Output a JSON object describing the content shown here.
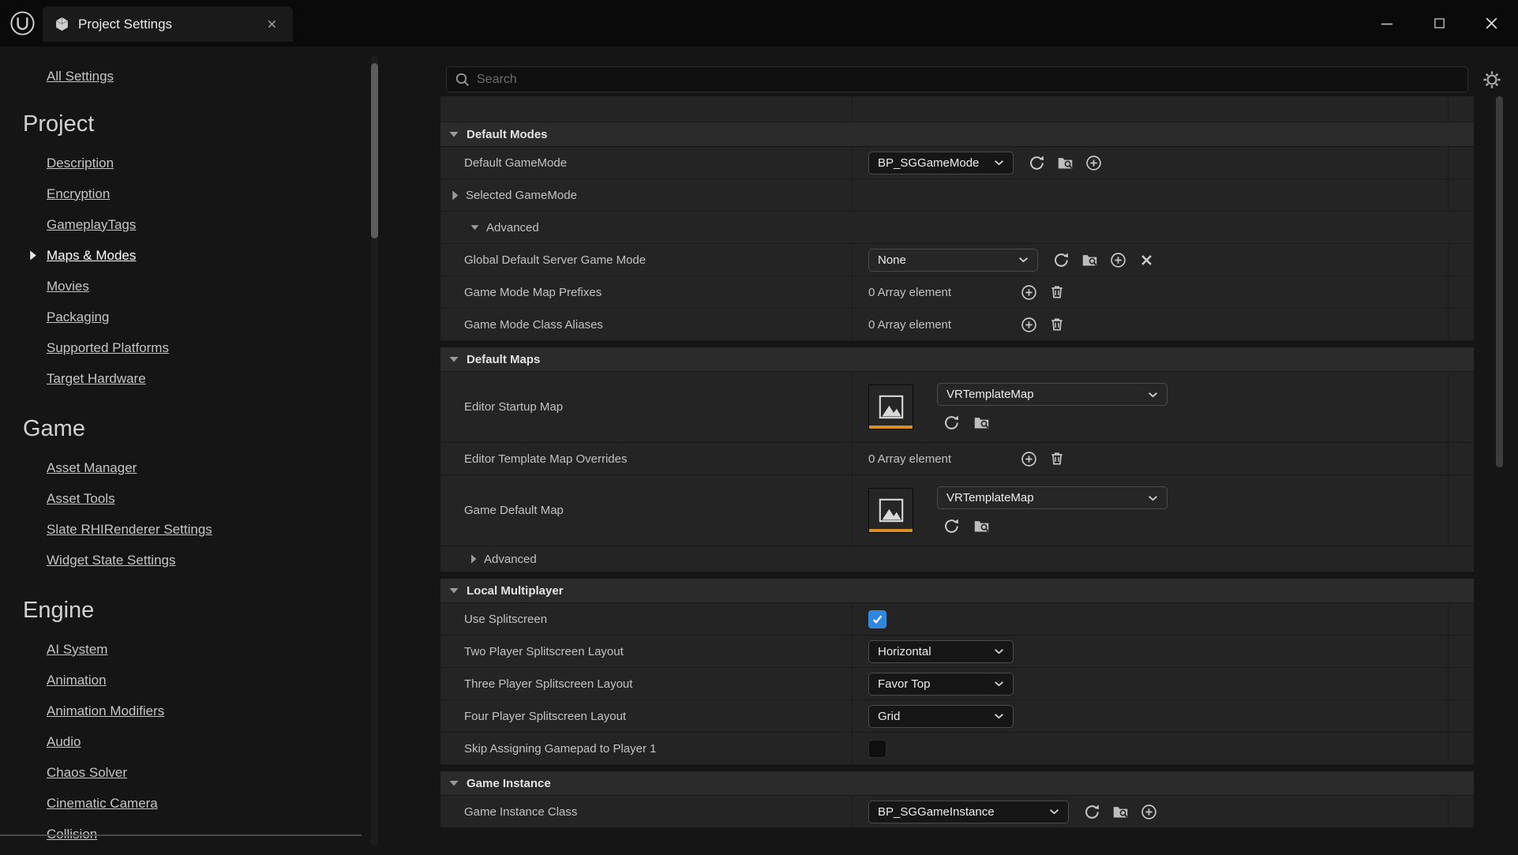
{
  "window": {
    "tab_title": "Project Settings"
  },
  "sidebar": {
    "all_settings": "All Settings",
    "selected_item": "Maps & Modes",
    "sections": [
      {
        "title": "Project",
        "items": [
          "Description",
          "Encryption",
          "GameplayTags",
          "Maps & Modes",
          "Movies",
          "Packaging",
          "Supported Platforms",
          "Target Hardware"
        ]
      },
      {
        "title": "Game",
        "items": [
          "Asset Manager",
          "Asset Tools",
          "Slate RHIRenderer Settings",
          "Widget State Settings"
        ]
      },
      {
        "title": "Engine",
        "items": [
          "AI System",
          "Animation",
          "Animation Modifiers",
          "Audio",
          "Chaos Solver",
          "Cinematic Camera",
          "Collision"
        ]
      }
    ]
  },
  "search": {
    "placeholder": "Search"
  },
  "panel": {
    "default_modes": {
      "title": "Default Modes",
      "default_gamemode": {
        "label": "Default GameMode",
        "value": "BP_SGGameMode"
      },
      "selected_gamemode": {
        "label": "Selected GameMode"
      },
      "advanced": {
        "label": "Advanced",
        "expanded": true
      },
      "global_default_server_game_mode": {
        "label": "Global Default Server Game Mode",
        "value": "None"
      },
      "game_mode_map_prefixes": {
        "label": "Game Mode Map Prefixes",
        "value": "0 Array element"
      },
      "game_mode_class_aliases": {
        "label": "Game Mode Class Aliases",
        "value": "0 Array element"
      }
    },
    "default_maps": {
      "title": "Default Maps",
      "editor_startup_map": {
        "label": "Editor Startup Map",
        "value": "VRTemplateMap"
      },
      "editor_template_map_overrides": {
        "label": "Editor Template Map Overrides",
        "value": "0 Array element"
      },
      "game_default_map": {
        "label": "Game Default Map",
        "value": "VRTemplateMap"
      },
      "advanced": {
        "label": "Advanced",
        "expanded": false
      }
    },
    "local_multiplayer": {
      "title": "Local Multiplayer",
      "use_splitscreen": {
        "label": "Use Splitscreen",
        "checked": true
      },
      "two_player_splitscreen_layout": {
        "label": "Two Player Splitscreen Layout",
        "value": "Horizontal"
      },
      "three_player_splitscreen_layout": {
        "label": "Three Player Splitscreen Layout",
        "value": "Favor Top"
      },
      "four_player_splitscreen_layout": {
        "label": "Four Player Splitscreen Layout",
        "value": "Grid"
      },
      "skip_assigning_gamepad": {
        "label": "Skip Assigning Gamepad to Player 1",
        "checked": false
      }
    },
    "game_instance": {
      "title": "Game Instance",
      "game_instance_class": {
        "label": "Game Instance Class",
        "value": "BP_SGGameInstance"
      }
    }
  },
  "icons": {
    "search": "magnifier",
    "view_options": "gear",
    "combo": "chevron-down",
    "category_expanded": "triangle-down",
    "category_collapsed": "triangle-right",
    "use_selected_asset": "circular-arrow",
    "browse_to_asset": "folder-magnifier",
    "add_element": "plus-circle",
    "clear": "x",
    "delete_array": "trash",
    "map_asset": "mountain-picture",
    "logo": "unreal-circle-u",
    "tab": "settings-cube"
  },
  "colors": {
    "accent_checkbox": "#2E86DD",
    "map_asset_underline": "#D78E25",
    "row_background": "#242424",
    "category_background": "#2B2B2B",
    "panel_background": "#151515",
    "titlebar_background": "#0A0A0A"
  }
}
